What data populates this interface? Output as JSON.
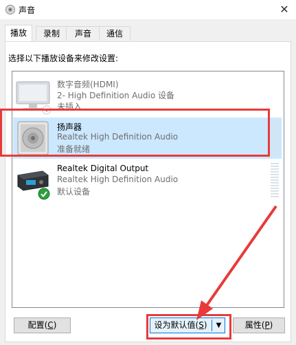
{
  "window": {
    "title": "声音",
    "icon": "speaker-icon"
  },
  "tabs": [
    {
      "label": "播放",
      "active": true
    },
    {
      "label": "录制",
      "active": false
    },
    {
      "label": "声音",
      "active": false
    },
    {
      "label": "通信",
      "active": false
    }
  ],
  "instruction": "选择以下播放设备来修改设置:",
  "devices": [
    {
      "name": "数字音频(HDMI)",
      "description": "2- High Definition Audio 设备",
      "status": "未插入",
      "icon": "monitor-icon",
      "badge": "red-down-arrow",
      "selected": false,
      "disabled": true
    },
    {
      "name": "扬声器",
      "description": "Realtek High Definition Audio",
      "status": "准备就绪",
      "icon": "speaker-icon",
      "badge": "",
      "selected": true,
      "disabled": false
    },
    {
      "name": "Realtek Digital Output",
      "description": "Realtek High Definition Audio",
      "status": "默认设备",
      "icon": "digital-output-icon",
      "badge": "green-check",
      "selected": false,
      "disabled": false
    }
  ],
  "buttons": {
    "configure": {
      "text": "配置(",
      "key": "C",
      "end": ")"
    },
    "set_default": {
      "text": "设为默认值(",
      "key": "S",
      "end": ")"
    },
    "properties": {
      "text": "属性(",
      "key": "P",
      "end": ")"
    }
  },
  "colors": {
    "selection": "#cce8ff",
    "annotation": "#e83a3a",
    "accent": "#0078d7"
  }
}
